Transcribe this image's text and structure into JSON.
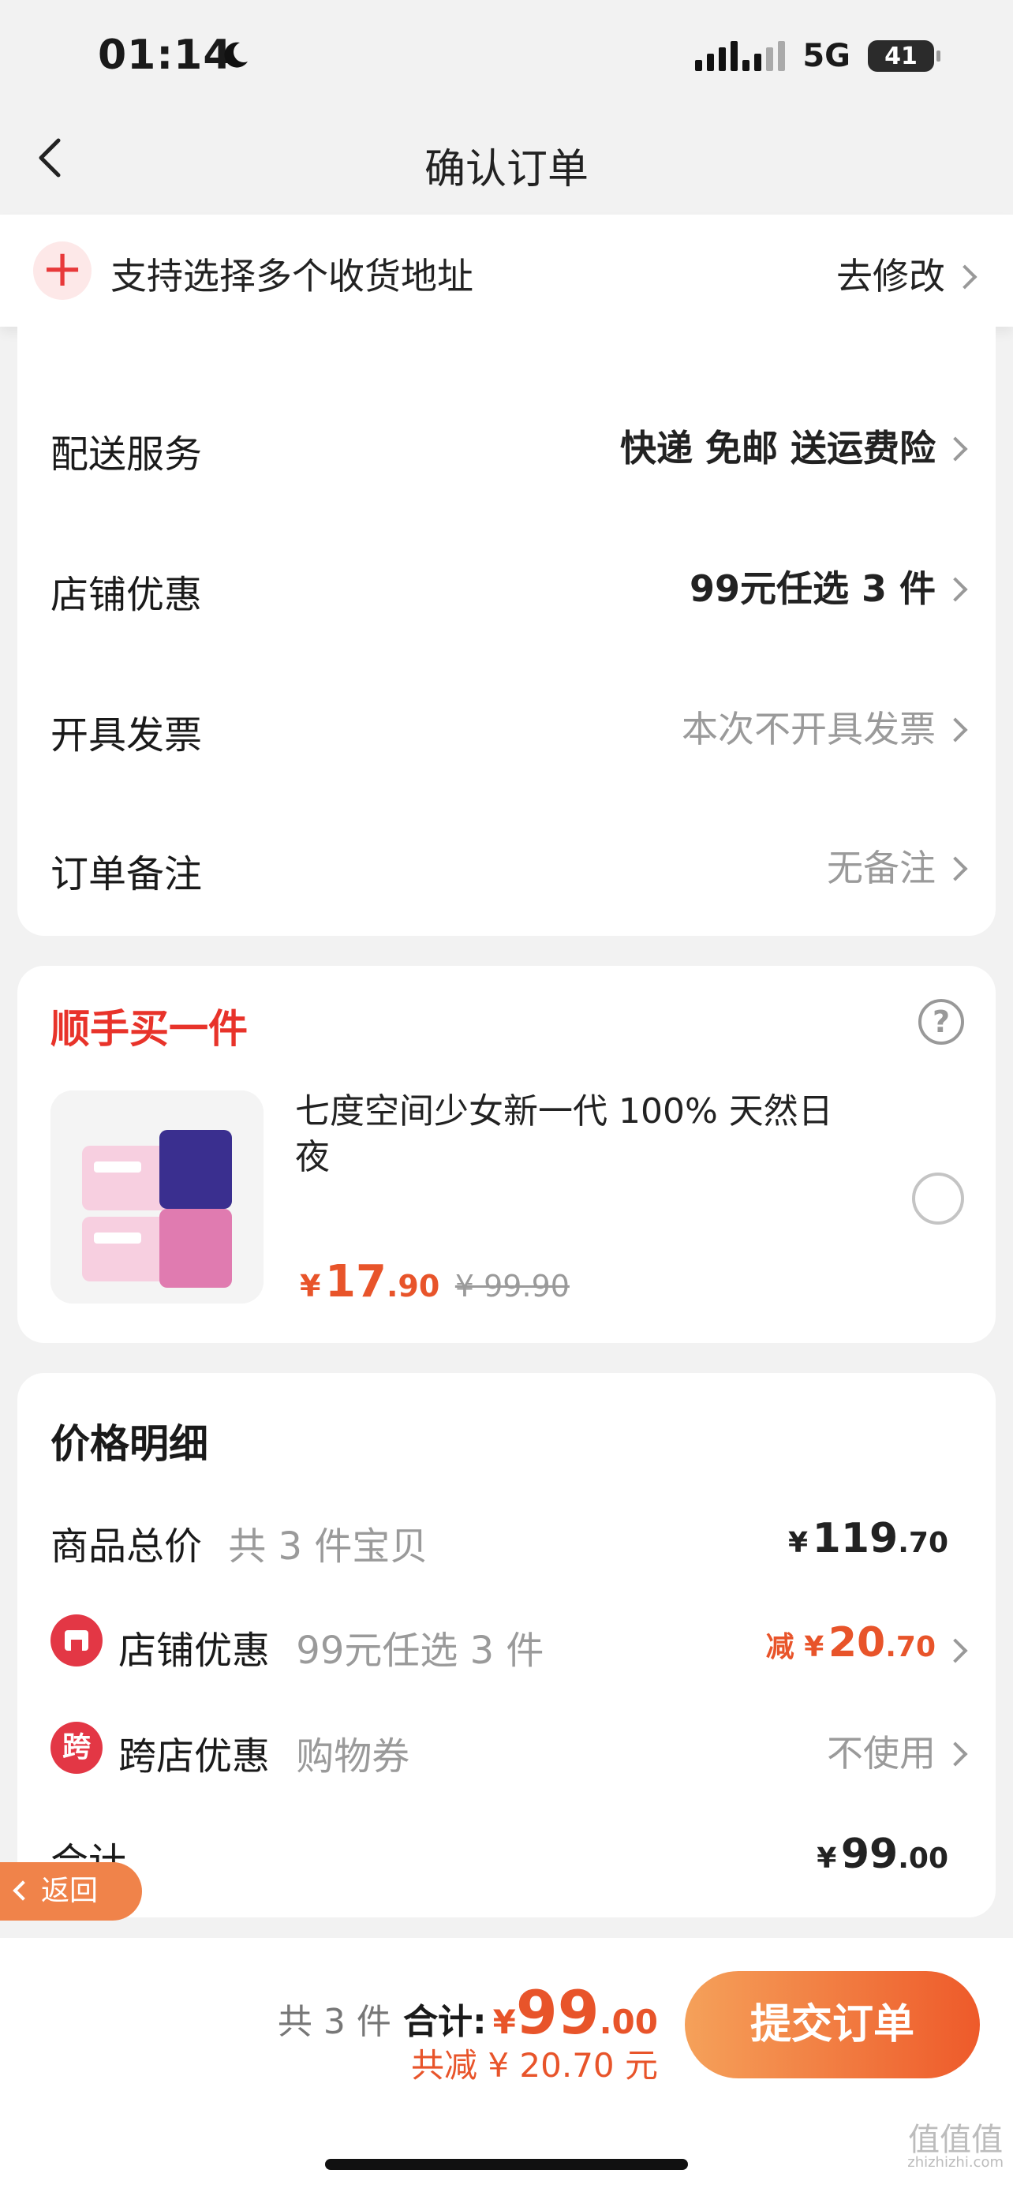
{
  "status_bar": {
    "time": "01:14",
    "network": "5G",
    "battery": "41"
  },
  "nav": {
    "title": "确认订单"
  },
  "address_banner": {
    "text": "支持选择多个收货地址",
    "action": "去修改"
  },
  "order_info": {
    "rows": [
      {
        "label": "配送服务",
        "value": "快递 免邮 送运费险"
      },
      {
        "label": "店铺优惠",
        "value": "99元任选 3 件"
      },
      {
        "label": "开具发票",
        "value": "本次不开具发票"
      },
      {
        "label": "订单备注",
        "value": "无备注"
      }
    ]
  },
  "upsell": {
    "title": "顺手买一件",
    "help_glyph": "?",
    "product": {
      "name": "七度空间少女新一代 100% 天然日夜",
      "currency": "¥",
      "price_int": "17",
      "price_dec": ".90",
      "original_price": "¥ 99.90"
    }
  },
  "price_detail": {
    "title": "价格明细",
    "total": {
      "label": "商品总价",
      "sub": "共 3 件宝贝",
      "currency": "¥",
      "int": "119",
      "dec": ".70"
    },
    "shop_discount": {
      "label": "店铺优惠",
      "sub": "99元任选 3 件",
      "prefix": "减 ¥",
      "int": "20",
      "dec": ".70"
    },
    "cross_store": {
      "label": "跨店优惠",
      "sub": "购物券",
      "value": "不使用",
      "icon_text": "跨"
    },
    "sum": {
      "label": "合计",
      "currency": "¥",
      "int": "99",
      "dec": ".00"
    }
  },
  "floating_back": {
    "label": "返回"
  },
  "bottom_bar": {
    "count": "共 3 件",
    "total_label": "合计:",
    "currency": "¥",
    "total_int": "99",
    "total_dec": ".00",
    "saved": "共减 ¥ 20.70 元",
    "submit": "提交订单"
  },
  "watermark": {
    "text": "值值值",
    "sub": "zhizhizhi.com"
  },
  "colors": {
    "accent": "#e8542a",
    "red": "#e8332a",
    "submit_gradient_start": "#f5a15a",
    "submit_gradient_end": "#ee5a2a"
  }
}
